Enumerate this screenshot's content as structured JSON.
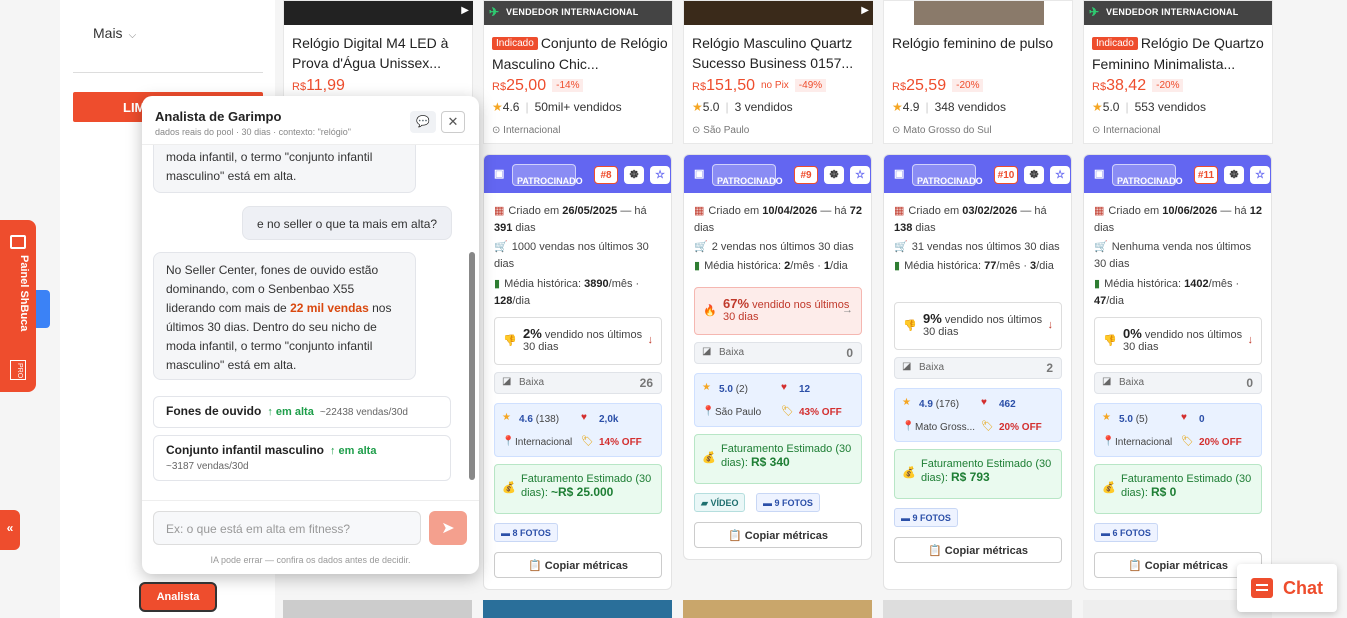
{
  "sidebar": {
    "mais": "Mais",
    "limpar": "LIMPAR"
  },
  "products": [
    {
      "title": "Relógio Digital M4 LED à Prova d'Água Unissex...",
      "indicado": "",
      "price": "11,99",
      "discount": "",
      "pix": "",
      "rating": "",
      "sold": "",
      "location": "",
      "intl": ""
    },
    {
      "title": "Conjunto de Relógio Masculino Chic...",
      "indicado": "Indicado",
      "price": "25,00",
      "discount": "-14%",
      "pix": "",
      "rating": "4.6",
      "sold": "50mil+ vendidos",
      "location": "Internacional",
      "intl": "VENDEDOR INTERNACIONAL"
    },
    {
      "title": "Relógio Masculino Quartz Sucesso Business 0157...",
      "indicado": "",
      "price": "151,50",
      "discount": "-49%",
      "pix": "no Pix",
      "rating": "5.0",
      "sold": "3 vendidos",
      "location": "São Paulo",
      "intl": ""
    },
    {
      "title": "Relógio feminino de pulso",
      "indicado": "",
      "price": "25,59",
      "discount": "-20%",
      "pix": "",
      "rating": "4.9",
      "sold": "348 vendidos",
      "location": "Mato Grosso do Sul",
      "intl": ""
    },
    {
      "title": "Relógio De Quartzo Feminino Minimalista...",
      "indicado": "Indicado",
      "price": "38,42",
      "discount": "-20%",
      "pix": "",
      "rating": "5.0",
      "sold": "553 vendidos",
      "location": "Internacional",
      "intl": "VENDEDOR INTERNACIONAL"
    }
  ],
  "currency": "R$",
  "metric_cards": [
    {
      "patrocinado": "PATROCINADO",
      "rank": "#8",
      "created_label": "Criado em",
      "created": "26/05/2025",
      "ago": "— há",
      "days": "391",
      "days_label": "dias",
      "sales": "1000 vendas nos últimos 30 dias",
      "media_label": "Média histórica:",
      "media_mes": "3890",
      "mes": "/mês ·",
      "media_dia": "128",
      "dia": "/dia",
      "pct": "2%",
      "pct_label": "vendido nos últimos 30 dias",
      "arrow": "↓",
      "level": "Baixa",
      "level_n": "26",
      "rating": "4.6",
      "reviews": "(138)",
      "likes": "2,0k",
      "loc": "Internacional",
      "off": "14% OFF",
      "fat_label": "Faturamento Estimado (30 dias):",
      "fat": "~R$ 25.000",
      "video": "",
      "fotos": "8 FOTOS",
      "copy": "Copiar métricas"
    },
    {
      "patrocinado": "PATROCINADO",
      "rank": "#9",
      "created_label": "Criado em",
      "created": "10/04/2026",
      "ago": "— há",
      "days": "72",
      "days_label": "dias",
      "sales": "2 vendas nos últimos 30 dias",
      "media_label": "Média histórica:",
      "media_mes": "2",
      "mes": "/mês ·",
      "media_dia": "1",
      "dia": "/dia",
      "pct": "67%",
      "pct_label": "vendido nos últimos 30 dias",
      "arrow": "→",
      "level": "Baixa",
      "level_n": "0",
      "rating": "5.0",
      "reviews": "(2)",
      "likes": "12",
      "loc": "São Paulo",
      "off": "43% OFF",
      "fat_label": "Faturamento Estimado (30 dias):",
      "fat": "R$ 340",
      "video": "VÍDEO",
      "fotos": "9 FOTOS",
      "copy": "Copiar métricas"
    },
    {
      "patrocinado": "PATROCINADO",
      "rank": "#10",
      "created_label": "Criado em",
      "created": "03/02/2026",
      "ago": "— há",
      "days": "138",
      "days_label": "dias",
      "sales": "31 vendas nos últimos 30 dias",
      "media_label": "Média histórica:",
      "media_mes": "77",
      "mes": "/mês ·",
      "media_dia": "3",
      "dia": "/dia",
      "pct": "9%",
      "pct_label": "vendido nos últimos 30 dias",
      "arrow": "↓",
      "level": "Baixa",
      "level_n": "2",
      "rating": "4.9",
      "reviews": "(176)",
      "likes": "462",
      "loc": "Mato Gross...",
      "off": "20% OFF",
      "fat_label": "Faturamento Estimado (30 dias):",
      "fat": "R$ 793",
      "video": "",
      "fotos": "9 FOTOS",
      "copy": "Copiar métricas"
    },
    {
      "patrocinado": "PATROCINADO",
      "rank": "#11",
      "created_label": "Criado em",
      "created": "10/06/2026",
      "ago": "— há",
      "days": "12",
      "days_label": "dias",
      "sales": "Nenhuma venda nos últimos 30 dias",
      "media_label": "Média histórica:",
      "media_mes": "1402",
      "mes": "/mês ·",
      "media_dia": "47",
      "dia": "/dia",
      "pct": "0%",
      "pct_label": "vendido nos últimos 30 dias",
      "arrow": "↓",
      "level": "Baixa",
      "level_n": "0",
      "rating": "5.0",
      "reviews": "(5)",
      "likes": "0",
      "loc": "Internacional",
      "off": "20% OFF",
      "fat_label": "Faturamento Estimado (30 dias):",
      "fat": "R$ 0",
      "video": "",
      "fotos": "6 FOTOS",
      "copy": "Copiar métricas"
    }
  ],
  "panel": {
    "title": "Analista de Garimpo",
    "subtitle": "dados reais do pool · 30 dias · contexto: \"relógio\"",
    "msg0": "moda infantil, o termo \"conjunto infantil masculino\" está em alta.",
    "user": "e no seller o que ta mais em alta?",
    "reply_a": "No Seller Center, fones de ouvido estão dominando, com o Senbenbao X55 liderando com mais de ",
    "reply_hl": "22 mil vendas",
    "reply_b": " nos últimos 30 dias. Dentro do seu nicho de moda infantil, o termo \"conjunto infantil masculino\" está em alta.",
    "trends": [
      {
        "name": "Fones de ouvido",
        "status": "↑ em alta",
        "count": "~22438 vendas/30d"
      },
      {
        "name": "Conjunto infantil masculino",
        "status": "↑ em alta",
        "count": "~3187 vendas/30d"
      }
    ],
    "placeholder": "Ex: o que está em alta em fitness?",
    "footer": "IA pode errar — confira os dados antes de decidir."
  },
  "analista": "Analista",
  "tab": {
    "label": "Painel ShBuca",
    "pro": "PRO"
  },
  "collapse": "«",
  "chat": "Chat"
}
